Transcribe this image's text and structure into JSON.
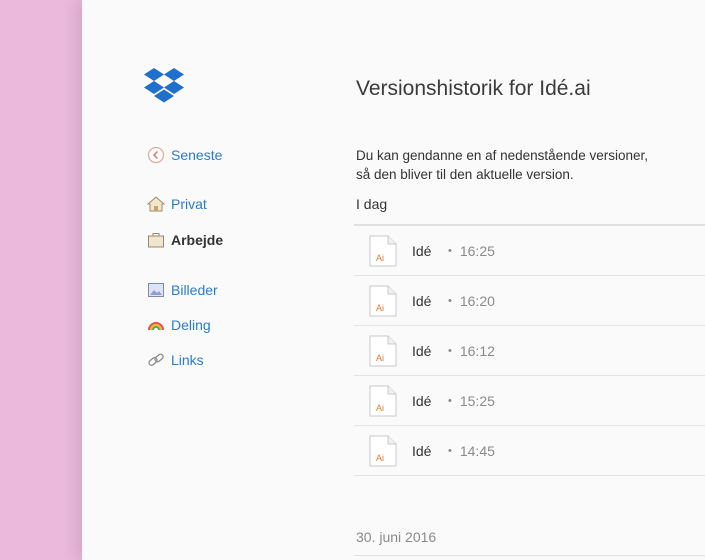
{
  "nav": {
    "recent": "Seneste",
    "private": "Privat",
    "work": "Arbejde",
    "photos": "Billeder",
    "sharing": "Deling",
    "links": "Links"
  },
  "main": {
    "title": "Versionshistorik for Idé.ai",
    "description_line1": "Du kan gendanne en af nedenstående versioner,",
    "description_line2": "så den bliver til den aktuelle version.",
    "today_label": "I dag",
    "file_icon_text": "Ai",
    "versions": [
      {
        "name": "Idé",
        "time": "16:25"
      },
      {
        "name": "Idé",
        "time": "16:20"
      },
      {
        "name": "Idé",
        "time": "16:12"
      },
      {
        "name": "Idé",
        "time": "15:25"
      },
      {
        "name": "Idé",
        "time": "14:45"
      }
    ],
    "older_date": "30. juni 2016"
  },
  "colors": {
    "accent": "#2a7ccf",
    "logo": "#1f6fcf",
    "background_left": "#ebb9db"
  }
}
